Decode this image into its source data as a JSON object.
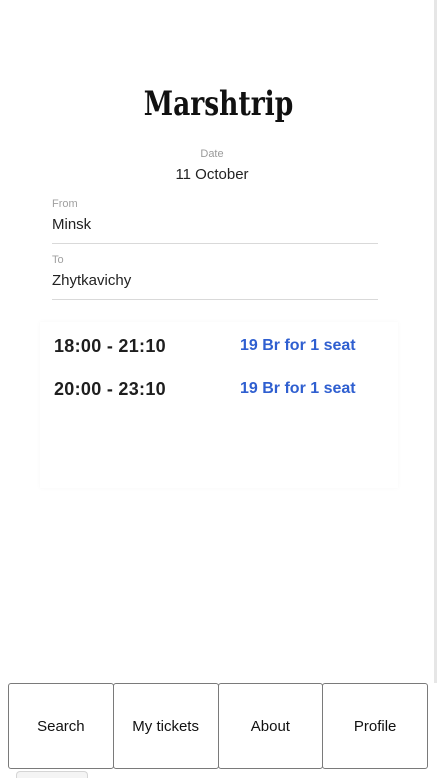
{
  "app": {
    "title": "Marshtrip"
  },
  "search": {
    "date_label": "Date",
    "date_value": "11 October",
    "from_label": "From",
    "from_value": "Minsk",
    "to_label": "To",
    "to_value": "Zhytkavichy"
  },
  "results": [
    {
      "time": "18:00 - 21:10",
      "price": "19 Br for 1 seat"
    },
    {
      "time": "20:00 - 23:10",
      "price": "19 Br for 1 seat"
    }
  ],
  "nav": {
    "items": [
      {
        "label": "Search"
      },
      {
        "label": "My tickets"
      },
      {
        "label": "About"
      },
      {
        "label": "Profile"
      }
    ]
  },
  "colors": {
    "price_accent": "#2f5fd0",
    "label_gray": "#9a9a9a"
  }
}
